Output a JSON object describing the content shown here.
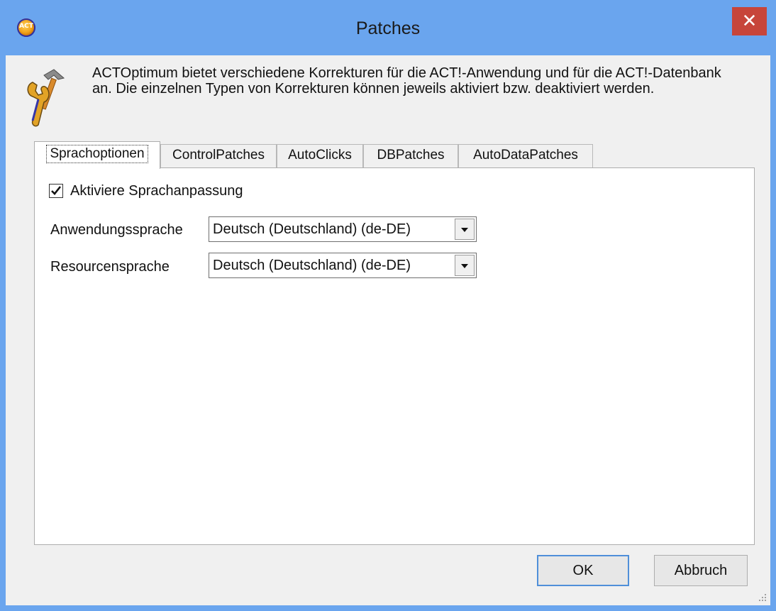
{
  "window": {
    "title": "Patches",
    "close_symbol": "✕",
    "app_icon": "act-logo-icon",
    "app_icon_text": "ACT"
  },
  "header": {
    "icon": "tools-icon",
    "description": "ACTOptimum bietet verschiedene Korrekturen für die ACT!-Anwendung und für die ACT!-Datenbank an. Die einzelnen Typen von Korrekturen können jeweils aktiviert bzw. deaktiviert werden."
  },
  "tabs": [
    {
      "label": "Sprachoptionen",
      "active": true
    },
    {
      "label": "ControlPatches",
      "active": false
    },
    {
      "label": "AutoClicks",
      "active": false
    },
    {
      "label": "DBPatches",
      "active": false
    },
    {
      "label": "AutoDataPatches",
      "active": false
    }
  ],
  "language": {
    "checkbox_label": "Aktiviere Sprachanpassung",
    "checkbox_checked": true,
    "app_language_label": "Anwendungssprache",
    "app_language_value": "Deutsch (Deutschland) (de-DE)",
    "resource_language_label": "Resourcensprache",
    "resource_language_value": "Deutsch (Deutschland) (de-DE)"
  },
  "buttons": {
    "ok": "OK",
    "cancel": "Abbruch"
  },
  "colors": {
    "titlebar": "#6aa5ee",
    "close": "#c7453a",
    "client": "#f0f0f0",
    "default_button_border": "#4f8fd9"
  }
}
